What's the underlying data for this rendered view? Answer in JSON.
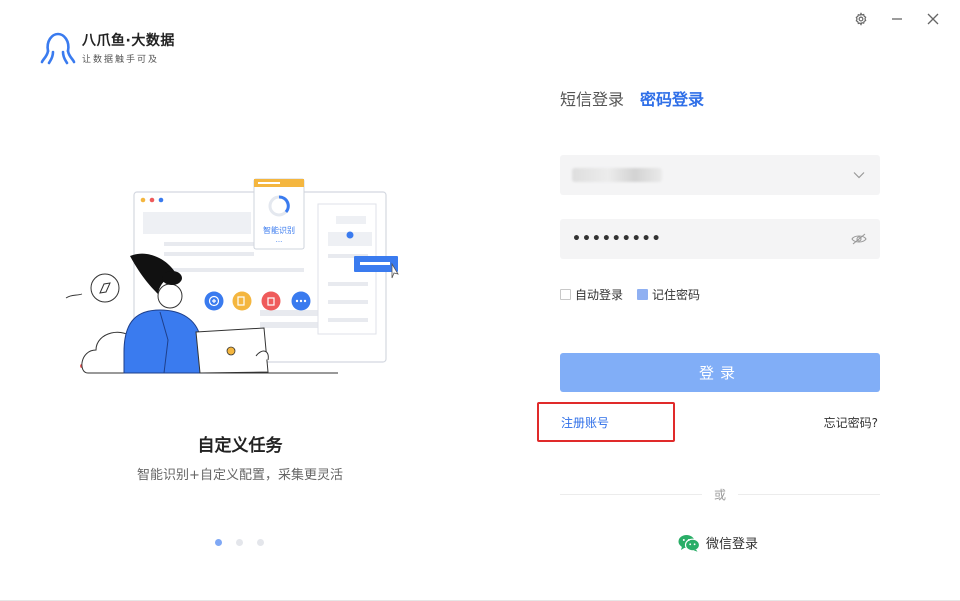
{
  "app": {
    "title": "八爪鱼·大数据",
    "subtitle": "让数据触手可及"
  },
  "illustration": {
    "card_label": "智能识别",
    "card_more": "...",
    "caption_title": "自定义任务",
    "caption_sub": "智能识别+自定义配置，采集更灵活",
    "active_slide": 1,
    "slide_count": 3
  },
  "login": {
    "tabs": [
      {
        "label": "短信登录",
        "active": false
      },
      {
        "label": "密码登录",
        "active": true
      }
    ],
    "username_value": "",
    "password_mask": "•••••••••",
    "auto_login_label": "自动登录",
    "auto_login_checked": false,
    "remember_label": "记住密码",
    "remember_checked": true,
    "submit_label": "登录",
    "register_label": "注册账号",
    "forgot_label": "忘记密码?",
    "or_label": "或",
    "wechat_label": "微信登录"
  },
  "colors": {
    "accent": "#2f6fe8",
    "button": "#81aef7",
    "highlight_box": "#e02a2a",
    "wechat": "#2aae67"
  },
  "icons": {
    "settings": "gear-icon",
    "minimize": "minimize-icon",
    "close": "close-icon",
    "dropdown": "chevron-down-icon",
    "toggle_password": "eye-slash-icon",
    "wechat": "wechat-icon"
  }
}
